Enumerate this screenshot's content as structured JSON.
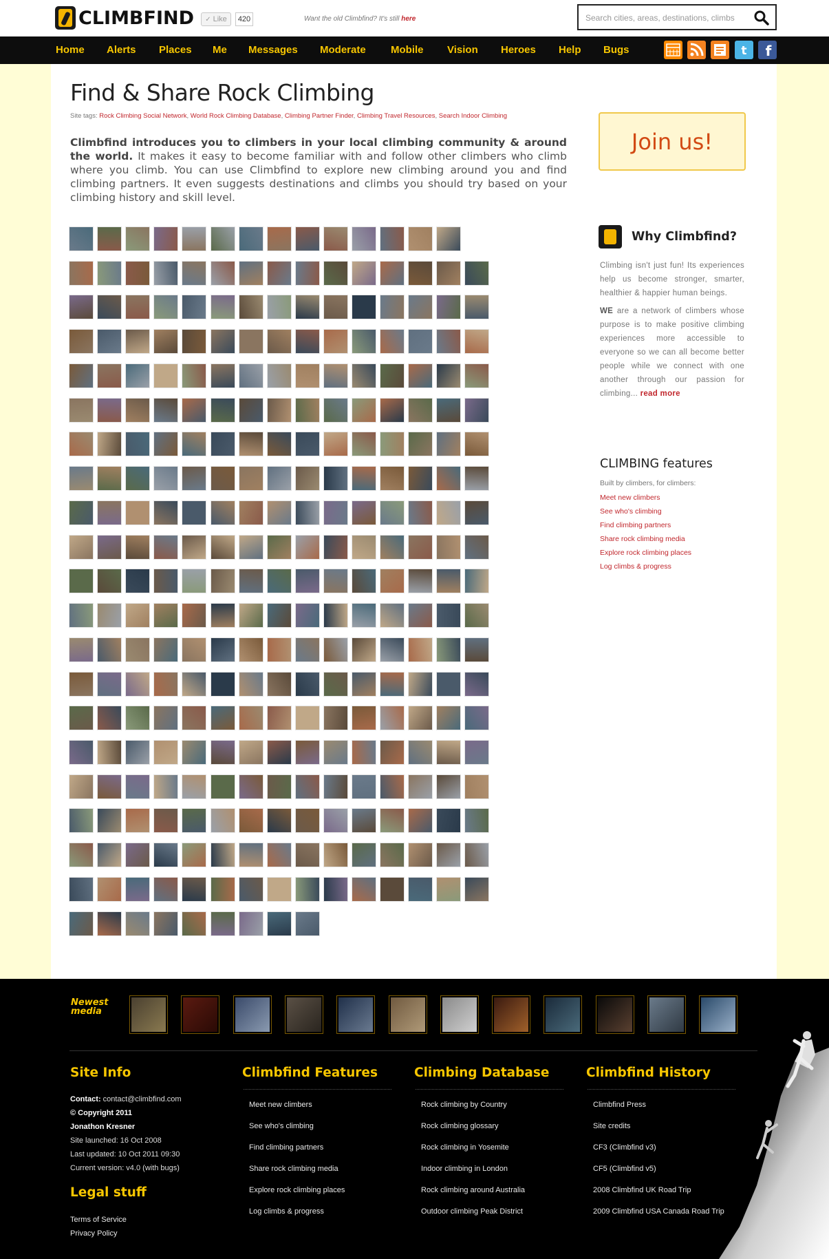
{
  "header": {
    "logo_text": "CLIMBFIND",
    "like_label": "Like",
    "like_count": "420",
    "old_site_note": "Want the old Climbfind? It's still ",
    "old_site_link": "here",
    "search_placeholder": "Search cities, areas, destinations, climbs",
    "search_icon": "search-icon"
  },
  "nav": {
    "items": [
      "Home",
      "Alerts",
      "Places",
      "Me",
      "Messages",
      "Moderate",
      "Mobile",
      "Vision",
      "Heroes",
      "Help",
      "Bugs"
    ],
    "social_icons": [
      "calendar-icon",
      "rss-icon",
      "feed-icon",
      "twitter-icon",
      "facebook-icon"
    ],
    "colors": {
      "bar": "#0d0d0d",
      "text": "#f7c600"
    }
  },
  "main": {
    "title": "Find & Share Rock Climbing",
    "tags_label": "Site tags: ",
    "tags": [
      "Rock Climbing Social Network",
      "World Rock Climbing Database",
      "Climbing Partner Finder",
      "Climbing Travel Resources",
      "Search Indoor Climbing"
    ],
    "intro_bold": "Climbfind introduces you to climbers in your local climbing community & around the world.",
    "intro_rest": " It makes it easy to become familiar with and follow other climbers who climb where you climb. You can use Climbfind to explore new climbing around you and find climbing partners. It even suggests destinations and climbs you should try based on your climbing history and skill level.",
    "photo_grid": {
      "rows": 21,
      "cols": 15,
      "last_row_count": 9,
      "first_row_count": 14
    }
  },
  "sidebar": {
    "join_label": "Join us!",
    "why_title": "Why Climbfind?",
    "why_p1": "Climbing isn't just fun! Its experiences help us become stronger, smarter, healthier & happier human beings.",
    "why_p2_bold": "WE",
    "why_p2": " are a network of climbers whose purpose is to make positive climbing experiences more accessible to everyone so we can all become better people while we connect with one another through our passion for climbing... ",
    "read_more": "read more",
    "features_title": "CLIMBING features",
    "features_sub": "Built by climbers, for climbers:",
    "features": [
      "Meet new climbers",
      "See who's climbing",
      "Find climbing partners",
      "Share rock climbing media",
      "Explore rock climbing places",
      "Log climbs & progress"
    ]
  },
  "footer": {
    "newest_label_1": "Newest",
    "newest_label_2": "media",
    "newest_count": 12,
    "site_info_title": "Site Info",
    "contact_label": "Contact:",
    "contact_value": " contact@climbfind.com",
    "copyright": "© Copyright 2011",
    "owner": "Jonathon Kresner",
    "launched": "Site launched: 16 Oct 2008",
    "updated": "Last updated: 10 Oct 2011 09:30",
    "version": "Current version: v4.0 (with bugs)",
    "legal_title": "Legal stuff",
    "legal": [
      "Terms of Service",
      "Privacy Policy"
    ],
    "columns": [
      {
        "title": "Climbfind Features",
        "items": [
          "Meet new climbers",
          "See who's climbing",
          "Find climbing partners",
          "Share rock climbing media",
          "Explore rock climbing places",
          "Log climbs & progress"
        ]
      },
      {
        "title": "Climbing Database",
        "items": [
          "Rock climbing by Country",
          "Rock climbing glossary",
          "Rock climbing in Yosemite",
          "Indoor climbing in London",
          "Rock climbing around Australia",
          "Outdoor climbing Peak District"
        ]
      },
      {
        "title": "Climbfind History",
        "items": [
          "Climbfind Press",
          "Site credits",
          "CF3 (Climbfind v3)",
          "CF5 (Climbfind v5)",
          "2008 Climbfind UK Road Trip",
          "2009 Climbfind USA Canada Road Trip"
        ]
      }
    ]
  }
}
